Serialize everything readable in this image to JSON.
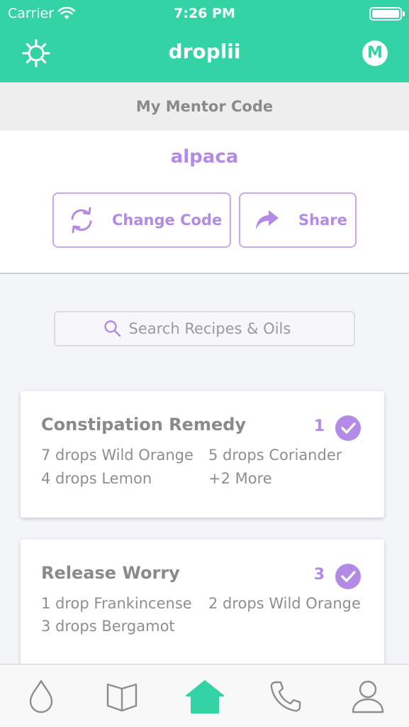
{
  "status_bar": {
    "carrier": "Carrier",
    "time": "7:26 PM"
  },
  "nav": {
    "title": "droplii",
    "profile_initial": "M"
  },
  "mentor": {
    "header": "My Mentor Code",
    "code": "alpaca",
    "change_label": "Change Code",
    "share_label": "Share"
  },
  "search": {
    "placeholder": "Search Recipes & Oils"
  },
  "recipes": [
    {
      "title": "Constipation Remedy",
      "count": "1",
      "ingredients": [
        "7 drops Wild Orange",
        "5 drops Coriander",
        "4 drops Lemon",
        "+2 More"
      ]
    },
    {
      "title": "Release Worry",
      "count": "3",
      "ingredients": [
        "1 drop Frankincense",
        "2 drops Wild Orange",
        "3 drops Bergamot"
      ]
    }
  ],
  "tabs": [
    {
      "icon": "drop-icon",
      "active": false
    },
    {
      "icon": "book-icon",
      "active": false
    },
    {
      "icon": "home-icon",
      "active": true
    },
    {
      "icon": "phone-icon",
      "active": false
    },
    {
      "icon": "user-icon",
      "active": false
    }
  ],
  "colors": {
    "brand_green": "#33d3a6",
    "accent_purple": "#b38be6",
    "text_gray": "#8a8a8a",
    "background": "#f4f5f9"
  }
}
